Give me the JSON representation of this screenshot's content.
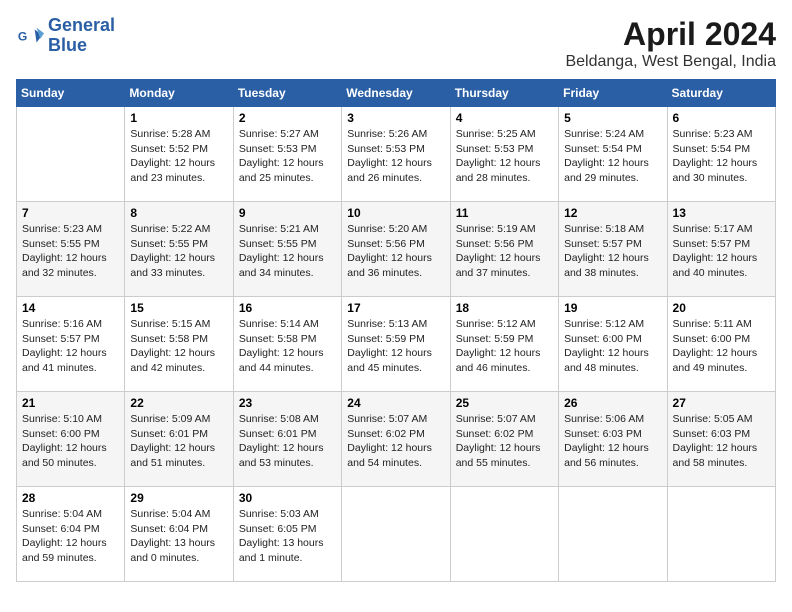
{
  "header": {
    "logo_line1": "General",
    "logo_line2": "Blue",
    "month": "April 2024",
    "location": "Beldanga, West Bengal, India"
  },
  "columns": [
    "Sunday",
    "Monday",
    "Tuesday",
    "Wednesday",
    "Thursday",
    "Friday",
    "Saturday"
  ],
  "weeks": [
    [
      {
        "num": "",
        "info": ""
      },
      {
        "num": "1",
        "info": "Sunrise: 5:28 AM\nSunset: 5:52 PM\nDaylight: 12 hours\nand 23 minutes."
      },
      {
        "num": "2",
        "info": "Sunrise: 5:27 AM\nSunset: 5:53 PM\nDaylight: 12 hours\nand 25 minutes."
      },
      {
        "num": "3",
        "info": "Sunrise: 5:26 AM\nSunset: 5:53 PM\nDaylight: 12 hours\nand 26 minutes."
      },
      {
        "num": "4",
        "info": "Sunrise: 5:25 AM\nSunset: 5:53 PM\nDaylight: 12 hours\nand 28 minutes."
      },
      {
        "num": "5",
        "info": "Sunrise: 5:24 AM\nSunset: 5:54 PM\nDaylight: 12 hours\nand 29 minutes."
      },
      {
        "num": "6",
        "info": "Sunrise: 5:23 AM\nSunset: 5:54 PM\nDaylight: 12 hours\nand 30 minutes."
      }
    ],
    [
      {
        "num": "7",
        "info": "Sunrise: 5:23 AM\nSunset: 5:55 PM\nDaylight: 12 hours\nand 32 minutes."
      },
      {
        "num": "8",
        "info": "Sunrise: 5:22 AM\nSunset: 5:55 PM\nDaylight: 12 hours\nand 33 minutes."
      },
      {
        "num": "9",
        "info": "Sunrise: 5:21 AM\nSunset: 5:55 PM\nDaylight: 12 hours\nand 34 minutes."
      },
      {
        "num": "10",
        "info": "Sunrise: 5:20 AM\nSunset: 5:56 PM\nDaylight: 12 hours\nand 36 minutes."
      },
      {
        "num": "11",
        "info": "Sunrise: 5:19 AM\nSunset: 5:56 PM\nDaylight: 12 hours\nand 37 minutes."
      },
      {
        "num": "12",
        "info": "Sunrise: 5:18 AM\nSunset: 5:57 PM\nDaylight: 12 hours\nand 38 minutes."
      },
      {
        "num": "13",
        "info": "Sunrise: 5:17 AM\nSunset: 5:57 PM\nDaylight: 12 hours\nand 40 minutes."
      }
    ],
    [
      {
        "num": "14",
        "info": "Sunrise: 5:16 AM\nSunset: 5:57 PM\nDaylight: 12 hours\nand 41 minutes."
      },
      {
        "num": "15",
        "info": "Sunrise: 5:15 AM\nSunset: 5:58 PM\nDaylight: 12 hours\nand 42 minutes."
      },
      {
        "num": "16",
        "info": "Sunrise: 5:14 AM\nSunset: 5:58 PM\nDaylight: 12 hours\nand 44 minutes."
      },
      {
        "num": "17",
        "info": "Sunrise: 5:13 AM\nSunset: 5:59 PM\nDaylight: 12 hours\nand 45 minutes."
      },
      {
        "num": "18",
        "info": "Sunrise: 5:12 AM\nSunset: 5:59 PM\nDaylight: 12 hours\nand 46 minutes."
      },
      {
        "num": "19",
        "info": "Sunrise: 5:12 AM\nSunset: 6:00 PM\nDaylight: 12 hours\nand 48 minutes."
      },
      {
        "num": "20",
        "info": "Sunrise: 5:11 AM\nSunset: 6:00 PM\nDaylight: 12 hours\nand 49 minutes."
      }
    ],
    [
      {
        "num": "21",
        "info": "Sunrise: 5:10 AM\nSunset: 6:00 PM\nDaylight: 12 hours\nand 50 minutes."
      },
      {
        "num": "22",
        "info": "Sunrise: 5:09 AM\nSunset: 6:01 PM\nDaylight: 12 hours\nand 51 minutes."
      },
      {
        "num": "23",
        "info": "Sunrise: 5:08 AM\nSunset: 6:01 PM\nDaylight: 12 hours\nand 53 minutes."
      },
      {
        "num": "24",
        "info": "Sunrise: 5:07 AM\nSunset: 6:02 PM\nDaylight: 12 hours\nand 54 minutes."
      },
      {
        "num": "25",
        "info": "Sunrise: 5:07 AM\nSunset: 6:02 PM\nDaylight: 12 hours\nand 55 minutes."
      },
      {
        "num": "26",
        "info": "Sunrise: 5:06 AM\nSunset: 6:03 PM\nDaylight: 12 hours\nand 56 minutes."
      },
      {
        "num": "27",
        "info": "Sunrise: 5:05 AM\nSunset: 6:03 PM\nDaylight: 12 hours\nand 58 minutes."
      }
    ],
    [
      {
        "num": "28",
        "info": "Sunrise: 5:04 AM\nSunset: 6:04 PM\nDaylight: 12 hours\nand 59 minutes."
      },
      {
        "num": "29",
        "info": "Sunrise: 5:04 AM\nSunset: 6:04 PM\nDaylight: 13 hours\nand 0 minutes."
      },
      {
        "num": "30",
        "info": "Sunrise: 5:03 AM\nSunset: 6:05 PM\nDaylight: 13 hours\nand 1 minute."
      },
      {
        "num": "",
        "info": ""
      },
      {
        "num": "",
        "info": ""
      },
      {
        "num": "",
        "info": ""
      },
      {
        "num": "",
        "info": ""
      }
    ]
  ]
}
